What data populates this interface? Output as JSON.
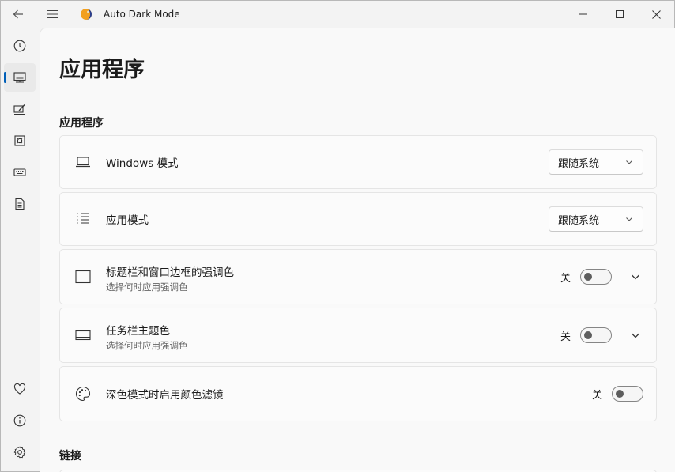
{
  "window": {
    "title": "Auto Dark Mode",
    "icons": [
      "back-icon",
      "hamburger-icon",
      "app-icon",
      "minimize-icon",
      "maximize-icon",
      "close-icon"
    ]
  },
  "nav": {
    "top_items": [
      {
        "icon": "clock-icon",
        "active": false
      },
      {
        "icon": "monitor-icon",
        "active": true
      },
      {
        "icon": "personalize-icon",
        "active": false
      },
      {
        "icon": "script-icon",
        "active": false
      },
      {
        "icon": "keyboard-icon",
        "active": false
      },
      {
        "icon": "document-icon",
        "active": false
      }
    ],
    "bottom_items": [
      {
        "icon": "heart-icon"
      },
      {
        "icon": "info-icon"
      },
      {
        "icon": "gear-icon"
      }
    ],
    "accent": "#005fb8"
  },
  "page": {
    "title": "应用程序",
    "section_apps": "应用程序",
    "section_links": "链接"
  },
  "settings": {
    "windows_mode": {
      "title": "Windows 模式",
      "value": "跟随系统",
      "icon": "laptop-icon"
    },
    "app_mode": {
      "title": "应用模式",
      "value": "跟随系统",
      "icon": "list-icon"
    },
    "titlebar_accent": {
      "title": "标题栏和窗口边框的强调色",
      "subtitle": "选择何时应用强调色",
      "state": "关",
      "on": false,
      "icon": "window-icon"
    },
    "taskbar_accent": {
      "title": "任务栏主题色",
      "subtitle": "选择何时应用强调色",
      "state": "关",
      "on": false,
      "icon": "taskbar-icon"
    },
    "color_filter": {
      "title": "深色模式时启用颜色滤镜",
      "state": "关",
      "on": false,
      "icon": "palette-icon"
    }
  }
}
